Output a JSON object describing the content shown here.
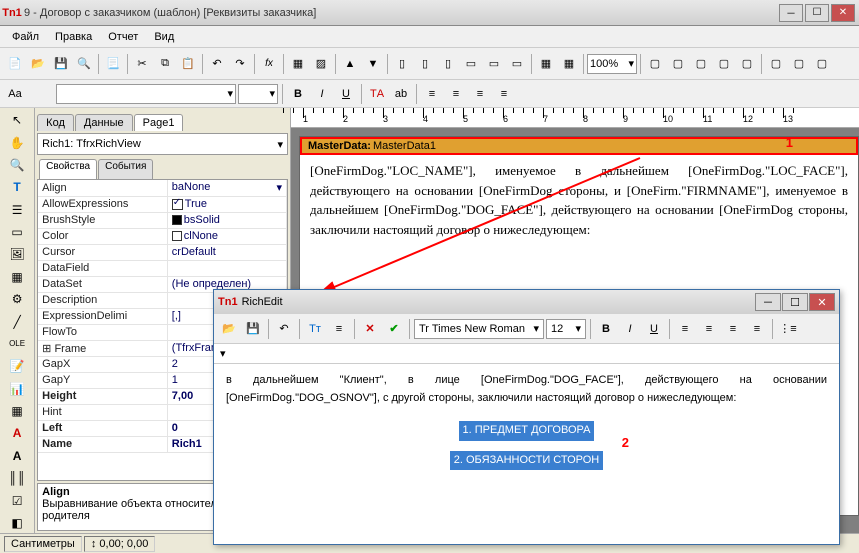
{
  "window": {
    "title": "9 - Договор с заказчиком (шаблон) [Реквизиты заказчика]",
    "appPrefix": "Tn1"
  },
  "menu": {
    "file": "Файл",
    "edit": "Правка",
    "report": "Отчет",
    "view": "Вид"
  },
  "format": {
    "zoom": "100%",
    "bold": "B",
    "italic": "I",
    "underline": "U"
  },
  "pageTabs": {
    "code": "Код",
    "data": "Данные",
    "page1": "Page1"
  },
  "objectSelector": "Rich1: TfrxRichView",
  "propTabs": {
    "props": "Свойства",
    "events": "События"
  },
  "properties": [
    {
      "k": "Align",
      "v": "baNone",
      "dd": true
    },
    {
      "k": "AllowExpressions",
      "v": "True",
      "chk": true
    },
    {
      "k": "BrushStyle",
      "v": "bsSolid",
      "sw": "#000"
    },
    {
      "k": "Color",
      "v": "clNone",
      "sw": "#fff"
    },
    {
      "k": "Cursor",
      "v": "crDefault"
    },
    {
      "k": "DataField",
      "v": ""
    },
    {
      "k": "DataSet",
      "v": "(Не определен)"
    },
    {
      "k": "Description",
      "v": ""
    },
    {
      "k": "ExpressionDelimiters",
      "v": "[,]",
      "kshort": "ExpressionDelimi"
    },
    {
      "k": "FlowTo",
      "v": ""
    },
    {
      "k": "Frame",
      "v": "(TfrxFrame)",
      "exp": true
    },
    {
      "k": "GapX",
      "v": "2"
    },
    {
      "k": "GapY",
      "v": "1"
    },
    {
      "k": "Height",
      "v": "7,00",
      "bold": true
    },
    {
      "k": "Hint",
      "v": ""
    },
    {
      "k": "Left",
      "v": "0",
      "bold": true
    },
    {
      "k": "Name",
      "v": "Rich1",
      "bold": true
    }
  ],
  "propHelp": {
    "title": "Align",
    "text": "Выравнивание объекта относительно родителя"
  },
  "band": {
    "label": "MasterData:",
    "name": "MasterData1"
  },
  "bodyText": "[OneFirmDog.\"LOC_NAME\"], именуемое в дальнейшем [OneFirmDog.\"LOC_FACE\"], действующего на основании [OneFirmDog стороны, и [OneFirm.\"FIRMNAME\"], именуемое в дальнейшем [OneFirmDog.\"DOG_FACE\"], действующего на основании [OneFirmDog стороны, заключили настоящий договор о нижеследующем:",
  "ruler": {
    "nums": [
      "1",
      "2",
      "3",
      "4",
      "5",
      "6",
      "7",
      "8",
      "9",
      "10",
      "11",
      "12",
      "13"
    ]
  },
  "annotations": {
    "a1": "1",
    "a2": "2"
  },
  "richedit": {
    "title": "RichEdit",
    "font": "Tr Times New Roman",
    "size": "12",
    "body": "в дальнейшем \"Клиент\", в лице [OneFirmDog.\"DOG_FACE\"], действующего на основании [OneFirmDog.\"DOG_OSNOV\"], c другой стороны, заключили настоящий договор о нижеследующем:",
    "sec1": "1. ПРЕДМЕТ ДОГОВОРА",
    "sec2": "2. ОБЯЗАННОСТИ СТОРОН"
  },
  "status": {
    "units": "Сантиметры",
    "coords": "0,00; 0,00"
  }
}
